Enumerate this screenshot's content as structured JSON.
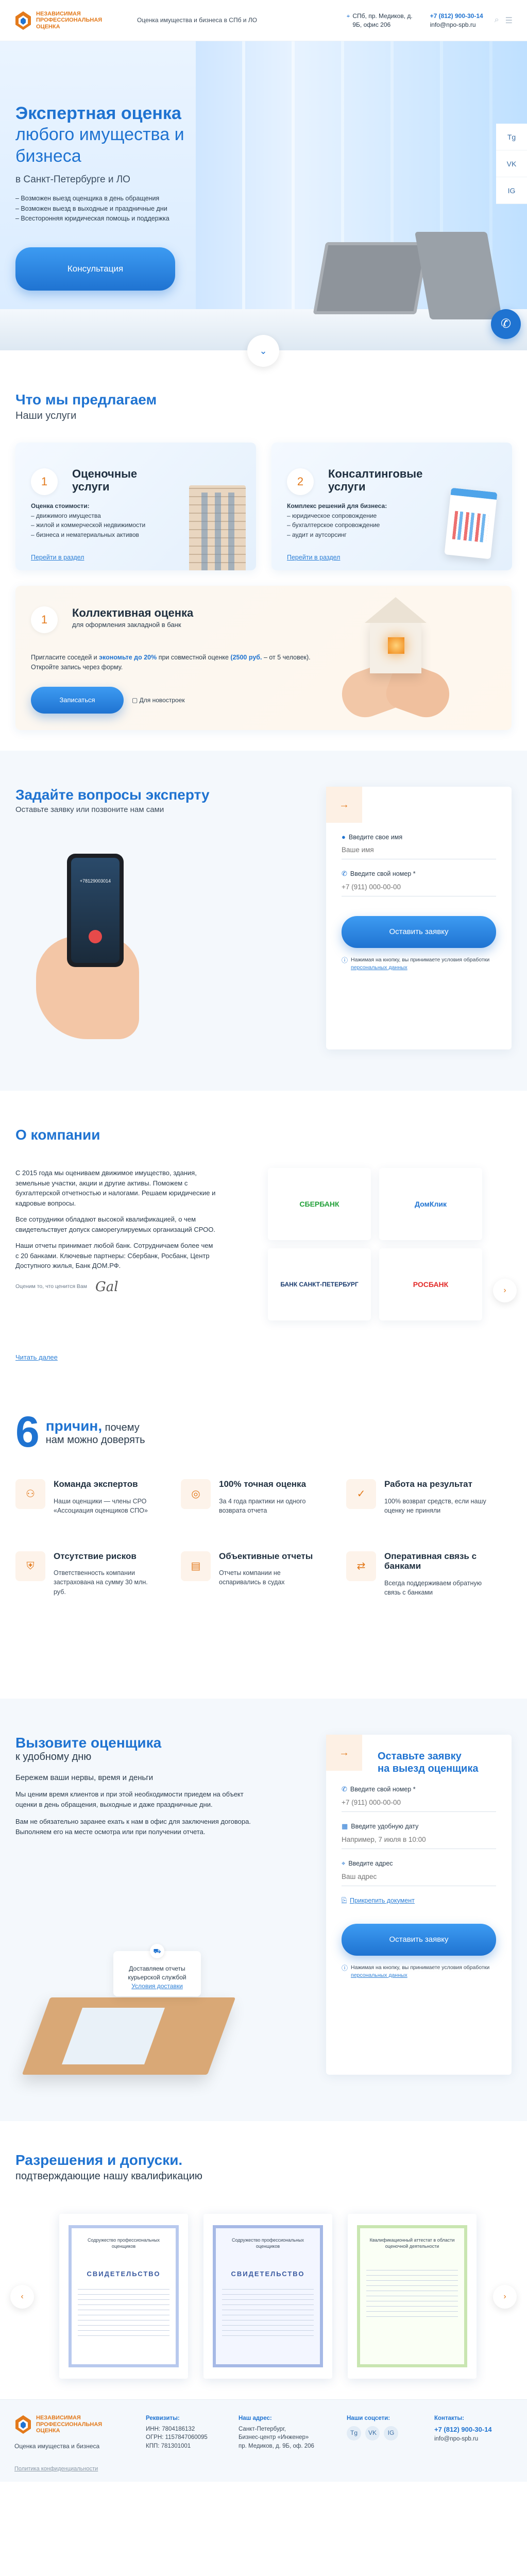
{
  "header": {
    "logo_text": "НЕЗАВИСИМАЯ ПРОФЕССИОНАЛЬНАЯ ОЦЕНКА",
    "tagline": "Оценка имущества и бизнеса в СПб и ЛО",
    "address": "СПб, пр. Медиков, д. 9Б, офис 206",
    "phone": "+7 (812) 900-30-14",
    "email": "info@npo-spb.ru"
  },
  "side_social": [
    "Tg",
    "VK",
    "IG"
  ],
  "hero": {
    "title": "Экспертная оценка",
    "subtitle": "любого имущества и бизнеса",
    "city": "в Санкт-Петербурге и ЛО",
    "bullets": [
      "– Возможен выезд оценщика в день обращения",
      "– Возможен выезд в выходные и праздничные дни",
      "– Всесторонняя юридическая помощь и поддержка"
    ],
    "cta": "Консультация"
  },
  "services": {
    "title": "Что мы предлагаем",
    "subtitle": "Наши услуги",
    "cards": [
      {
        "num": "1",
        "title_l1": "Оценочные",
        "title_l2": "услуги",
        "head": "Оценка стоимости:",
        "items": [
          "– движимого имущества",
          "– жилой и коммерческой недвижимости",
          "– бизнеса и нематериальных активов"
        ],
        "link": "Перейти в раздел"
      },
      {
        "num": "2",
        "title_l1": "Консалтинговые",
        "title_l2": "услуги",
        "head": "Комплекс решений для бизнеса:",
        "items": [
          "– юридическое сопровождение",
          "– бухгалтерское сопровождение",
          "– аудит и аутсорсинг"
        ],
        "link": "Перейти в раздел"
      }
    ],
    "wide": {
      "num": "1",
      "title": "Коллективная оценка",
      "subtitle": "для оформления закладной в банк",
      "text_a": "Пригласите соседей и ",
      "text_b": "экономьте до 20%",
      "text_c": " при совместной оценке ",
      "text_d": "(2500 руб.",
      "text_e": " – от 5 человек). Откройте запись через форму.",
      "button": "Записаться",
      "link": "Для новостроек"
    }
  },
  "expert": {
    "title": "Задайте вопросы эксперту",
    "subtitle": "Оставьте заявку или позвоните нам сами",
    "phone_number": "+78129003014",
    "name_label": "Введите свое имя",
    "name_placeholder": "Ваше имя",
    "phone_label": "Введите свой номер *",
    "phone_placeholder": "+7 (911) 000-00-00",
    "button": "Оставить заявку",
    "agree_text": "Нажимая на кнопку, вы принимаете условия обработки ",
    "agree_link": "персональных данных"
  },
  "about": {
    "title": "О компании",
    "p1": "С 2015 года мы оцениваем движимое имущество, здания, земельные участки, акции и другие активы. Поможем с бухгалтерской отчетностью и налогами. Решаем юридические и кадровые вопросы.",
    "p2": "Все сотрудники обладают высокой квалификацией, о чем свидетельствует допуск саморегулируемых организаций СРОО.",
    "p3": "Наши отчеты принимает любой банк. Сотрудничаем более чем с 20 банками. Ключевые партнеры: Сбербанк, Росбанк, Центр Доступного жилья, Банк ДОМ.РФ.",
    "sign": "Оценим то, что ценится Вам",
    "sig": "Gal",
    "more": "Читать далее",
    "partners": [
      "СБЕРБАНК",
      "ДомКлик",
      "БАНК САНКТ-ПЕТЕРБУРГ",
      "РОСБАНК"
    ]
  },
  "reasons": {
    "num": "6",
    "word": "причин,",
    "tail": " почему",
    "sub": "нам можно доверять",
    "items": [
      {
        "title": "Команда экспертов",
        "desc": "Наши оценщики — члены СРО «Ассоциация оценщиков СПО»"
      },
      {
        "title": "100% точная оценка",
        "desc": "За 4 года практики ни одного возврата отчета"
      },
      {
        "title": "Работа на результат",
        "desc": "100% возврат средств, если нашу оценку не приняли"
      },
      {
        "title": "Отсутствие рисков",
        "desc": "Ответственность компании застрахована на сумму 30 млн. руб."
      },
      {
        "title": "Объективные отчеты",
        "desc": "Отчеты компании не оспаривались в судах"
      },
      {
        "title": "Оперативная связь с банками",
        "desc": "Всегда поддерживаем обратную связь с банками"
      }
    ]
  },
  "appraiser": {
    "title": "Вызовите оценщика",
    "subtitle": "к удобному дню",
    "lead": "Бережем ваши нервы, время и деньги",
    "p1": "Мы ценим время клиентов и при этой необходимости приедем на объект оценки в день обращения, выходные и даже праздничные дни.",
    "p2": "Вам не обязательно заранее ехать к нам в офис для заключения договора. Выполняем его на месте осмотра или при получении отчета.",
    "bubble_text": "Доставляем отчеты курьерской службой",
    "bubble_link": "Условия доставки",
    "form_title_l1": "Оставьте заявку",
    "form_title_l2": "на выезд оценщика",
    "phone_label": "Введите свой номер *",
    "phone_placeholder": "+7 (911) 000-00-00",
    "date_label": "Введите удобную дату",
    "date_placeholder": "Например, 7 июля в 10:00",
    "addr_label": "Введите адрес",
    "addr_placeholder": "Ваш адрес",
    "attach": "Прикрепить документ",
    "button": "Оставить заявку",
    "agree_text": "Нажимая на кнопку, вы принимаете условия обработки ",
    "agree_link": "персональных данных"
  },
  "licenses": {
    "title": "Разрешения и допуски.",
    "subtitle": "подтверждающие нашу квалификацию",
    "certs": [
      {
        "org": "Содружество профессиональных оценщиков",
        "label": "СВИДЕТЕЛЬСТВО"
      },
      {
        "org": "Содружество профессиональных оценщиков",
        "label": "СВИДЕТЕЛЬСТВО"
      },
      {
        "org": "Квалификационный аттестат в области оценочной деятельности",
        "label": ""
      }
    ]
  },
  "footer": {
    "tag": "Оценка имущества и бизнеса",
    "req_title": "Реквизиты:",
    "req": [
      "ИНН: 7804186132",
      "ОГРН: 1157847060095",
      "КПП: 781301001"
    ],
    "addr_title": "Наш адрес:",
    "addr": [
      "Санкт-Петербург,",
      "Бизнес-центр «Инженер»",
      "пр. Медиков, д. 9Б, оф. 206"
    ],
    "social_title": "Наши соцсети:",
    "social": [
      "Tg",
      "VK",
      "IG"
    ],
    "contacts_title": "Контакты:",
    "phone": "+7 (812) 900-30-14",
    "email": "info@npo-spb.ru",
    "policy": "Политика конфиденциальности"
  }
}
